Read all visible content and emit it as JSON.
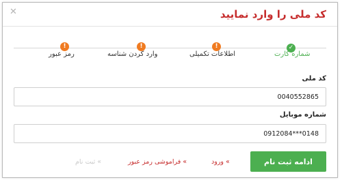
{
  "dialog": {
    "title": "کد ملی را وارد نمایید",
    "close_icon": "close-icon"
  },
  "steps": [
    {
      "label": "شماره کارت",
      "icon": "check-icon",
      "status": "done",
      "icon_glyph": "✓"
    },
    {
      "label": "اطلاعات تکمیلی",
      "icon": "warning-icon",
      "status": "pending",
      "icon_glyph": "!"
    },
    {
      "label": "وارد کردن شناسه",
      "icon": "warning-icon",
      "status": "pending",
      "icon_glyph": "!"
    },
    {
      "label": "رمز عبور",
      "icon": "warning-icon",
      "status": "pending",
      "icon_glyph": "!"
    }
  ],
  "form": {
    "national_code_label": "کد ملی",
    "national_code_value": "0040552865",
    "mobile_label": "شماره موبایل",
    "mobile_value": "0912084***0148"
  },
  "actions": {
    "continue_label": "ادامه ثبت نام",
    "login_link": "» ورود",
    "forgot_link": "» فراموشی رمز عبور",
    "register_link": "» ثبت نام"
  },
  "colors": {
    "accent_red": "#c62d2d",
    "success_green": "#4caf50",
    "warning_orange": "#f07b21"
  }
}
